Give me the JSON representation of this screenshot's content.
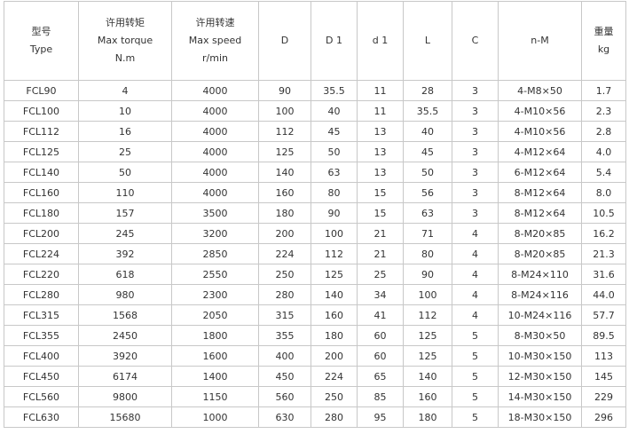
{
  "columns": [
    {
      "lines": [
        "型号",
        "Type"
      ]
    },
    {
      "lines": [
        "许用转矩",
        "Max torque",
        "N.m"
      ]
    },
    {
      "lines": [
        "许用转速",
        "Max speed",
        "r/min"
      ]
    },
    {
      "lines": [
        "D"
      ]
    },
    {
      "lines": [
        "D 1"
      ]
    },
    {
      "lines": [
        "d 1"
      ]
    },
    {
      "lines": [
        "L"
      ]
    },
    {
      "lines": [
        "C"
      ]
    },
    {
      "lines": [
        "n-M"
      ]
    },
    {
      "lines": [
        "重量",
        "kg"
      ]
    }
  ],
  "rows": [
    [
      "FCL90",
      "4",
      "4000",
      "90",
      "35.5",
      "11",
      "28",
      "3",
      "4-M8×50",
      "1.7"
    ],
    [
      "FCL100",
      "10",
      "4000",
      "100",
      "40",
      "11",
      "35.5",
      "3",
      "4-M10×56",
      "2.3"
    ],
    [
      "FCL112",
      "16",
      "4000",
      "112",
      "45",
      "13",
      "40",
      "3",
      "4-M10×56",
      "2.8"
    ],
    [
      "FCL125",
      "25",
      "4000",
      "125",
      "50",
      "13",
      "45",
      "3",
      "4-M12×64",
      "4.0"
    ],
    [
      "FCL140",
      "50",
      "4000",
      "140",
      "63",
      "13",
      "50",
      "3",
      "6-M12×64",
      "5.4"
    ],
    [
      "FCL160",
      "110",
      "4000",
      "160",
      "80",
      "15",
      "56",
      "3",
      "8-M12×64",
      "8.0"
    ],
    [
      "FCL180",
      "157",
      "3500",
      "180",
      "90",
      "15",
      "63",
      "3",
      "8-M12×64",
      "10.5"
    ],
    [
      "FCL200",
      "245",
      "3200",
      "200",
      "100",
      "21",
      "71",
      "4",
      "8-M20×85",
      "16.2"
    ],
    [
      "FCL224",
      "392",
      "2850",
      "224",
      "112",
      "21",
      "80",
      "4",
      "8-M20×85",
      "21.3"
    ],
    [
      "FCL220",
      "618",
      "2550",
      "250",
      "125",
      "25",
      "90",
      "4",
      "8-M24×110",
      "31.6"
    ],
    [
      "FCL280",
      "980",
      "2300",
      "280",
      "140",
      "34",
      "100",
      "4",
      "8-M24×116",
      "44.0"
    ],
    [
      "FCL315",
      "1568",
      "2050",
      "315",
      "160",
      "41",
      "112",
      "4",
      "10-M24×116",
      "57.7"
    ],
    [
      "FCL355",
      "2450",
      "1800",
      "355",
      "180",
      "60",
      "125",
      "5",
      "8-M30×50",
      "89.5"
    ],
    [
      "FCL400",
      "3920",
      "1600",
      "400",
      "200",
      "60",
      "125",
      "5",
      "10-M30×150",
      "113"
    ],
    [
      "FCL450",
      "6174",
      "1400",
      "450",
      "224",
      "65",
      "140",
      "5",
      "12-M30×150",
      "145"
    ],
    [
      "FCL560",
      "9800",
      "1150",
      "560",
      "250",
      "85",
      "160",
      "5",
      "14-M30×150",
      "229"
    ],
    [
      "FCL630",
      "15680",
      "1000",
      "630",
      "280",
      "95",
      "180",
      "5",
      "18-M30×150",
      "296"
    ]
  ]
}
